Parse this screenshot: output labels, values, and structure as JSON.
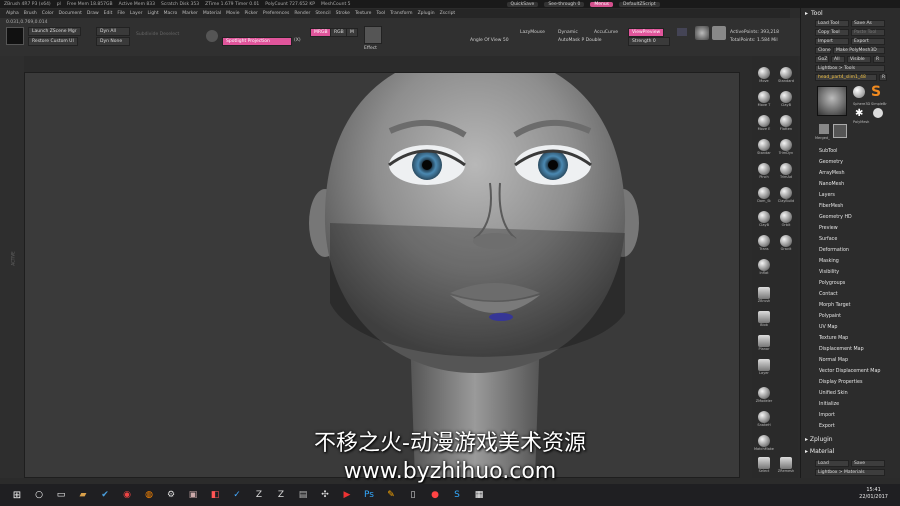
{
  "titlebar": {
    "app": "ZBrush 4R7 P3 (x64)",
    "user": "pl",
    "free_mem": "Free Mem 18.857GB",
    "active_mem": "Active Mem 833",
    "scratch": "Scratch Disk 353",
    "timer": "ZTime 1.679 Timer 0.01",
    "polycount": "PolyCount 727.652 KP",
    "meshcount": "MeshCount 5",
    "quicksave": "QuickSave",
    "seethrough": "See-through 0",
    "menus": "Menus",
    "script": "DefaultZScript"
  },
  "menubar": [
    "Alpha",
    "Brush",
    "Color",
    "Document",
    "Draw",
    "Edit",
    "File",
    "Layer",
    "Light",
    "Macro",
    "Marker",
    "Material",
    "Movie",
    "Picker",
    "Preferences",
    "Render",
    "Stencil",
    "Stroke",
    "Texture",
    "Tool",
    "Transform",
    "Zplugin",
    "Zscript"
  ],
  "shelf": {
    "coords": "0.031,0.769,0.014",
    "launch": "Launch ZScene Mgr",
    "restore": "Restore Custom UI",
    "dynall": "Dyn All",
    "dynnone": "Dyn None",
    "ghost": "Subdivide Deselect",
    "spotlight": "Spotlight Projection",
    "spot_key": "(X)",
    "mrgb": "MRGB",
    "rgb": "RGB",
    "m": "M",
    "effect": "Effect",
    "lazymouse": "LazyMouse",
    "dynamic": "Dynamic",
    "accucurve": "AccuCurve",
    "viewpreview": "ViewPreview",
    "angle": "Angle Of View 50",
    "autohush": "AutoMask P Double",
    "strength": "Strength 0",
    "active_points": "ActivePoints: 393,218",
    "total_points": "TotalPoints: 1.584 Mil"
  },
  "rshelf": [
    "Move",
    "Standard",
    "Move T",
    "ClayB",
    "Move E",
    "Flatten",
    "Standar",
    "TrimDyn",
    "Pinch",
    "TrimAd",
    "Dam_St",
    "ClayBuild",
    "ClayB",
    "Orbit",
    "Trans",
    "Gravit",
    "Inflat",
    "ZBrush",
    "Blob",
    "Planar",
    "Layer",
    "ZModeler",
    "SnakeH",
    "MatchMaker",
    "Select",
    "ZRemesh",
    "Selecta",
    "Zoom",
    "Optim",
    "Actual"
  ],
  "rpanel": {
    "tool_title": "Tool",
    "load_tool": "Load Tool",
    "save_as": "Save As",
    "copy_tool": "Copy Tool",
    "paste_tool": "Paste Tool",
    "import": "Import",
    "export": "Export",
    "clone": "Clone",
    "make": "Make PolyMesh3D",
    "goz": "GoZ",
    "all": "All",
    "visible": "Visible",
    "r": "R",
    "lightbox_tools": "Lightbox > Tools",
    "current_tool": "head_part4_slim1_48",
    "current_num": "R",
    "thumb_labels": [
      "Sphere3D",
      "SimpleBr",
      "PolyMesh",
      "Merged_"
    ],
    "subtool_items": [
      "SubTool",
      "Geometry",
      "ArrayMesh",
      "NanoMesh",
      "Layers",
      "FiberMesh",
      "Geometry HD",
      "Preview",
      "Surface",
      "Deformation",
      "Masking",
      "Visibility",
      "Polygroups",
      "Contact",
      "Morph Target",
      "Polypaint",
      "UV Map",
      "Texture Map",
      "Displacement Map",
      "Normal Map",
      "Vector Displacement Map",
      "Display Properties",
      "Unified Skin",
      "Initialize",
      "Import",
      "Export"
    ],
    "zplugin": "Zplugin",
    "material": "Material",
    "load": "Load",
    "save": "Save",
    "lightbox_mat": "Lightbox > Materials",
    "fill": "Fill",
    "all_low": "All Low"
  },
  "leftstrip_labels": [
    "ACTIVE"
  ],
  "watermark": {
    "line1": "不移之火-动漫游戏美术资源",
    "line2": "www.byzhihuo.com"
  },
  "taskbar": {
    "time": "15:41",
    "date": "22/01/2017"
  }
}
